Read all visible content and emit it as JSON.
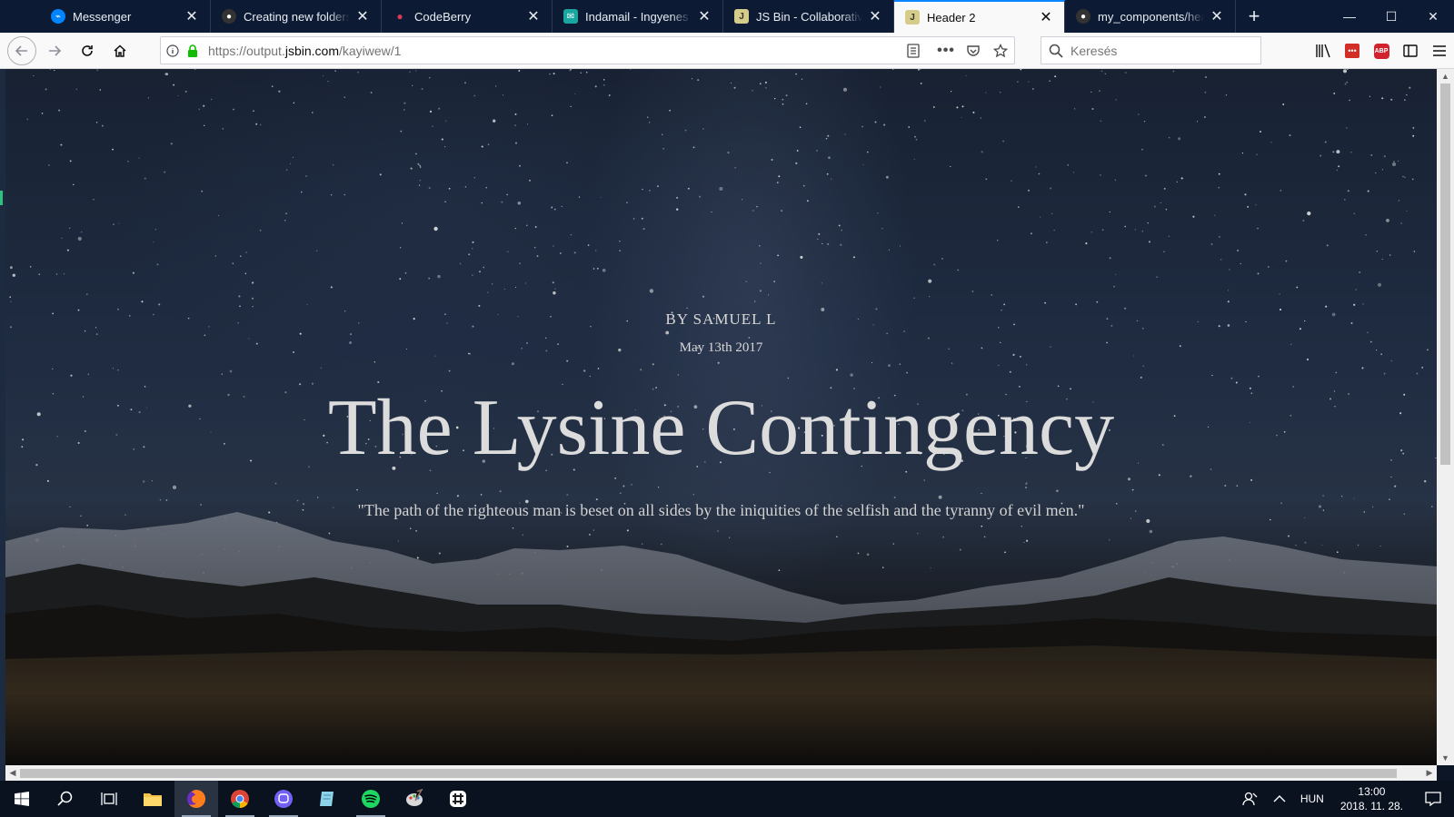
{
  "browser": {
    "tabs": [
      {
        "title": "Messenger",
        "favicon_color": "#0084ff"
      },
      {
        "title": "Creating new folders in G",
        "favicon_color": "#333333"
      },
      {
        "title": "CodeBerry",
        "favicon_color": "#d23a56"
      },
      {
        "title": "Indamail - Ingyenes ema",
        "favicon_color": "#1aa6a0"
      },
      {
        "title": "JS Bin - Collaborative Jav",
        "favicon_color": "#d6cc8a"
      },
      {
        "title": "Header 2",
        "favicon_color": "#d6cc8a",
        "active": true
      },
      {
        "title": "my_components/header",
        "favicon_color": "#333333"
      }
    ],
    "url_prefix": "https://output.",
    "url_domain": "jsbin.com",
    "url_path": "/kayiwew/1",
    "search_placeholder": "Keresés"
  },
  "page": {
    "byline": "BY SAMUEL L",
    "date": "May 13th 2017",
    "headline": "The Lysine Contingency",
    "quote": "\"The path of the righteous man is beset on all sides by the iniquities of the selfish and the tyranny of evil men.\""
  },
  "taskbar": {
    "language": "HUN",
    "time": "13:00",
    "date": "2018. 11. 28."
  }
}
